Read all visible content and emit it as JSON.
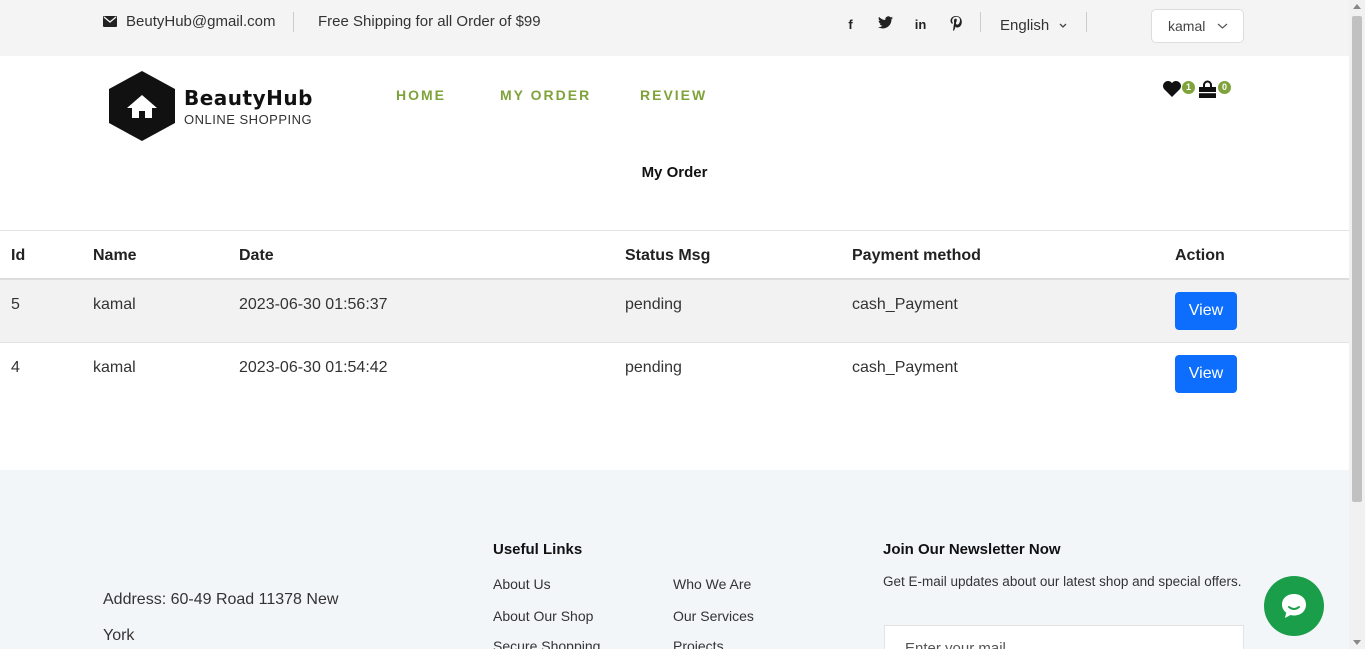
{
  "topbar": {
    "email": "BeutyHub@gmail.com",
    "shipping": "Free Shipping for all Order of $99",
    "socials": [
      "facebook-icon",
      "twitter-icon",
      "linkedin-icon",
      "pinterest-icon"
    ],
    "language": "English",
    "user": "kamal"
  },
  "header": {
    "brand": "BeautyHub",
    "tagline": "ONLINE SHOPPING",
    "nav": [
      "HOME",
      "MY ORDER",
      "REVIEW"
    ],
    "wishlist_count": "1",
    "cart_count": "0"
  },
  "page_title": "My Order",
  "table": {
    "columns": [
      "Id",
      "Name",
      "Date",
      "Status Msg",
      "Payment method",
      "Action"
    ],
    "rows": [
      {
        "id": "5",
        "name": "kamal",
        "date": "2023-06-30 01:56:37",
        "status": "pending",
        "payment": "cash_Payment",
        "action": "View"
      },
      {
        "id": "4",
        "name": "kamal",
        "date": "2023-06-30 01:54:42",
        "status": "pending",
        "payment": "cash_Payment",
        "action": "View"
      }
    ]
  },
  "footer": {
    "address": "Address: 60-49 Road 11378 New York",
    "useful_links_title": "Useful Links",
    "links_col1": [
      "About Us",
      "About Our Shop",
      "Secure Shopping"
    ],
    "links_col2": [
      "Who We Are",
      "Our Services",
      "Projects"
    ],
    "newsletter_title": "Join Our Newsletter Now",
    "newsletter_text": "Get E-mail updates about our latest shop and special offers.",
    "newsletter_placeholder": "Enter your mail"
  },
  "colors": {
    "accent": "#7fa33a",
    "button": "#0d6efd",
    "chat": "#1a9e4a"
  }
}
